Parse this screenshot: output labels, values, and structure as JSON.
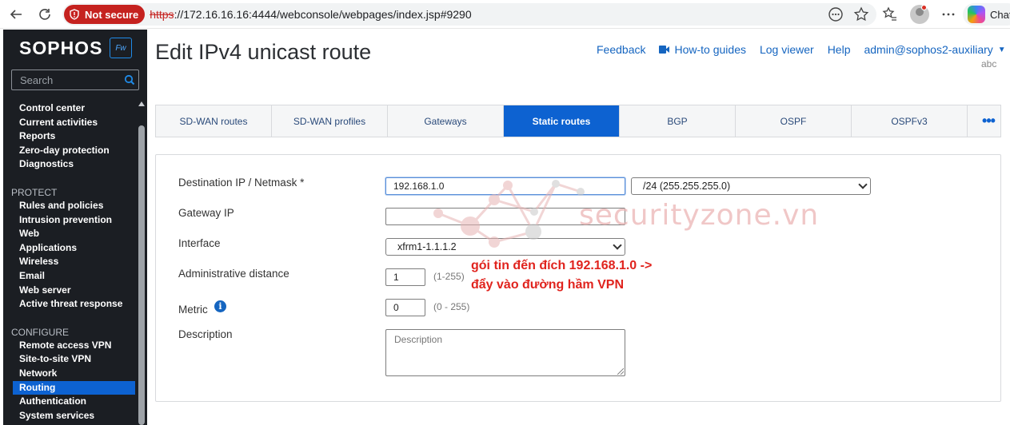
{
  "browser": {
    "security_label": "Not secure",
    "url_protocol": "https",
    "url_rest": "://172.16.16.16:4444/webconsole/webpages/index.jsp#9290",
    "copilot_label": "Chat"
  },
  "brand": {
    "name": "SOPHOS",
    "badge": "Fw"
  },
  "sidebar": {
    "search_placeholder": "Search",
    "top_items": [
      "Control center",
      "Current activities",
      "Reports",
      "Zero-day protection",
      "Diagnostics"
    ],
    "protect_label": "PROTECT",
    "protect_items": [
      "Rules and policies",
      "Intrusion prevention",
      "Web",
      "Applications",
      "Wireless",
      "Email",
      "Web server",
      "Active threat response"
    ],
    "configure_label": "CONFIGURE",
    "configure_items": [
      "Remote access VPN",
      "Site-to-site VPN",
      "Network",
      "Routing",
      "Authentication",
      "System services"
    ],
    "active_item": "Routing"
  },
  "header": {
    "title": "Edit IPv4 unicast route",
    "feedback": "Feedback",
    "how_to": "How-to guides",
    "log_viewer": "Log viewer",
    "help": "Help",
    "admin": "admin@sophos2-auxiliary",
    "device": "abc"
  },
  "tabs": [
    "SD-WAN routes",
    "SD-WAN profiles",
    "Gateways",
    "Static routes",
    "BGP",
    "OSPF",
    "OSPFv3"
  ],
  "active_tab": "Static routes",
  "more_tabs": "•••",
  "form": {
    "dest_label": "Destination IP / Netmask *",
    "dest_value": "192.168.1.0",
    "netmask_value": "/24 (255.255.255.0)",
    "gateway_label": "Gateway IP",
    "gateway_value": "",
    "interface_label": "Interface",
    "interface_value": "xfrm1-1.1.1.2",
    "admin_distance_label": "Administrative distance",
    "admin_distance_value": "1",
    "admin_distance_hint": "(1-255)",
    "metric_label": "Metric",
    "metric_value": "0",
    "metric_hint": "(0 - 255)",
    "description_label": "Description",
    "description_placeholder": "Description"
  },
  "watermark": "securityzone.vn",
  "annotation": {
    "line1": "gói tin đến đích 192.168.1.0 ->",
    "line2": "đẩy vào đường hầm VPN"
  }
}
